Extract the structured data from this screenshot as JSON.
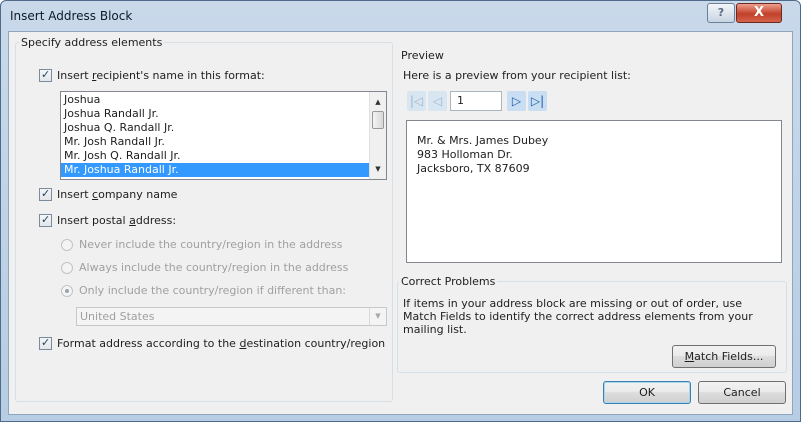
{
  "window": {
    "title": "Insert Address Block",
    "help_glyph": "?",
    "close_glyph": "X"
  },
  "left": {
    "group_label": "Specify address elements",
    "recipient_name": {
      "pre": "Insert ",
      "ul": "r",
      "post": "ecipient's name in this format:",
      "checked": true
    },
    "name_formats": [
      "Joshua",
      "Joshua Randall Jr.",
      "Joshua Q. Randall Jr.",
      "Mr. Josh Randall Jr.",
      "Mr. Josh Q. Randall Jr.",
      "Mr. Joshua Randall Jr."
    ],
    "selected_format_index": 5,
    "company": {
      "pre": "Insert ",
      "ul": "c",
      "post": "ompany name",
      "checked": true
    },
    "postal": {
      "pre": "Insert postal ",
      "ul": "a",
      "post": "ddress:",
      "checked": true
    },
    "country_options": [
      {
        "label": "Never include the country/region in the address",
        "selected": false
      },
      {
        "label": "Always include the country/region in the address",
        "selected": false
      },
      {
        "label": "Only include the country/region if different than:",
        "selected": true
      }
    ],
    "country_value": "United States",
    "format_dest": {
      "pre": "Format address according to the ",
      "ul": "d",
      "post": "estination country/region",
      "checked": true
    }
  },
  "preview": {
    "group_label": "Preview",
    "intro": "Here is a preview from your recipient list:",
    "record_number": "1",
    "address_lines": [
      "Mr. & Mrs. James Dubey",
      "983 Holloman Dr.",
      "Jacksboro, TX 87609"
    ]
  },
  "correct": {
    "group_label": "Correct Problems",
    "text_lines": [
      "If items in your address block are missing or out of order, use",
      "Match Fields to identify the correct address elements from your",
      "mailing list."
    ],
    "match_button": {
      "ul": "M",
      "post": "atch Fields..."
    }
  },
  "footer": {
    "ok_label": "OK",
    "cancel_label": "Cancel"
  }
}
